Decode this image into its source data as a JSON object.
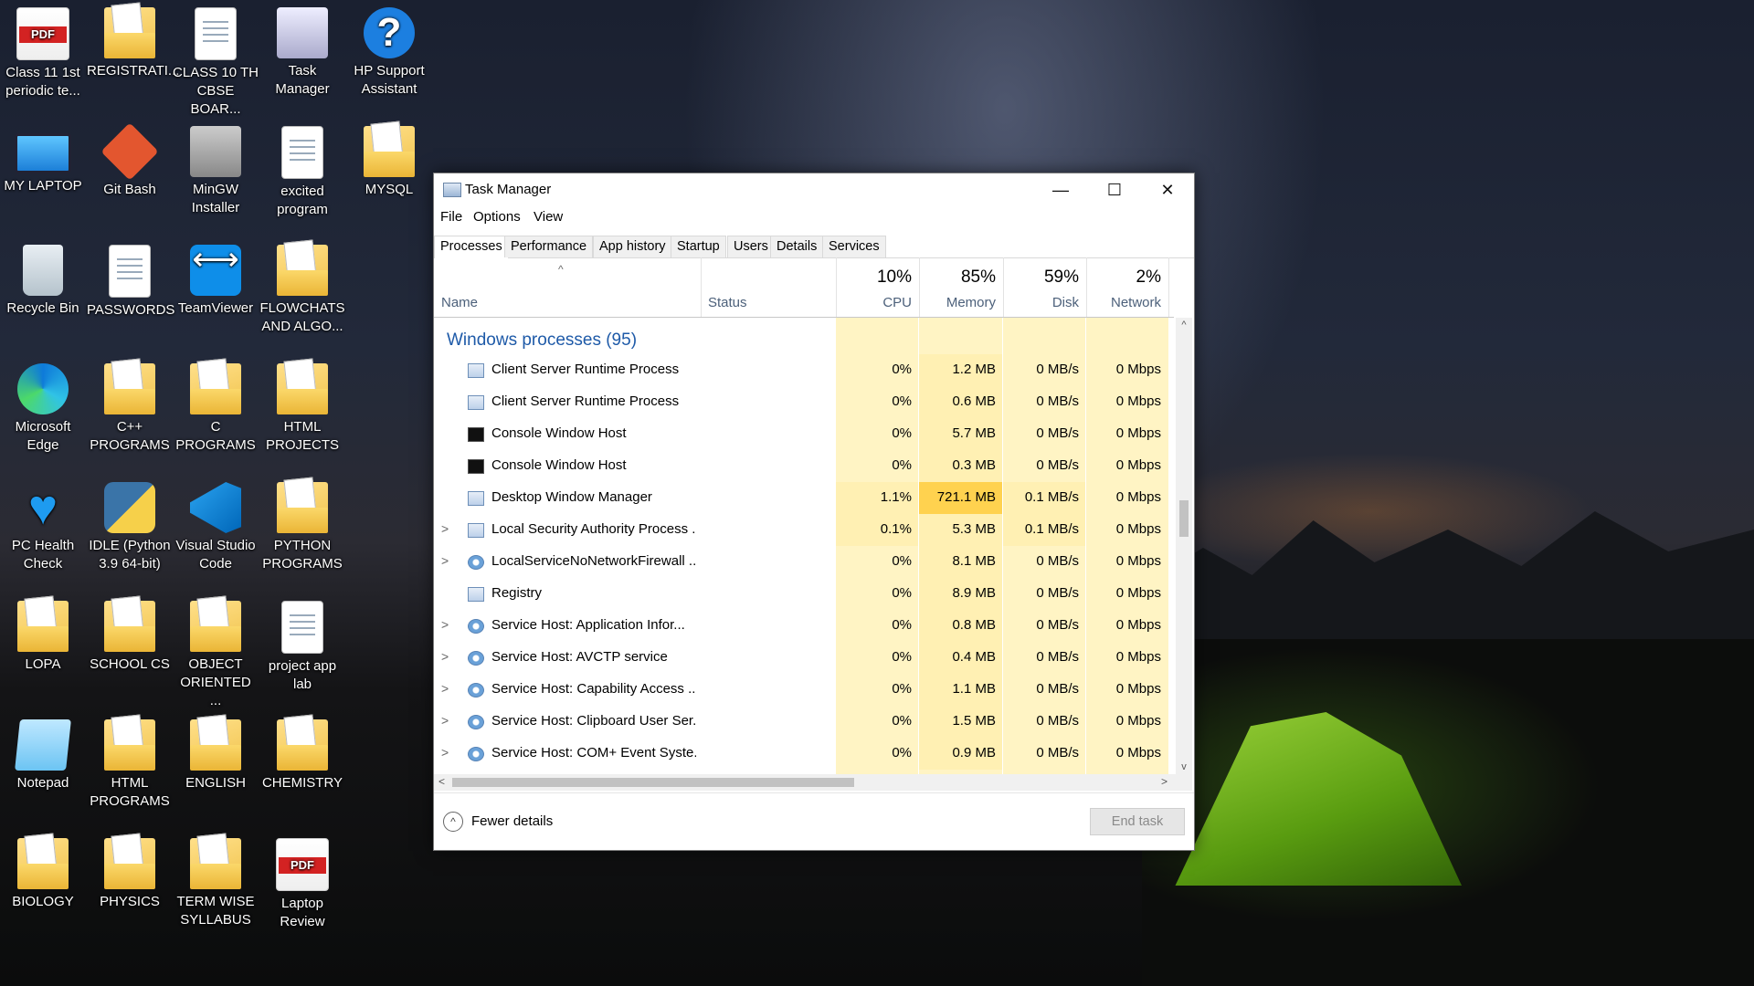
{
  "desktop": {
    "icons": [
      {
        "label": "Class 11 1st periodic te...",
        "icon": "pdf-icon"
      },
      {
        "label": "REGISTRATI...",
        "icon": "folder-icon"
      },
      {
        "label": "CLASS 10 TH CBSE BOAR...",
        "icon": "document-icon"
      },
      {
        "label": "Task Manager",
        "icon": "task-manager-icon"
      },
      {
        "label": "HP Support Assistant",
        "icon": "help-icon"
      },
      {
        "label": "MY LAPTOP",
        "icon": "laptop-icon"
      },
      {
        "label": "Git Bash",
        "icon": "git-icon"
      },
      {
        "label": "MinGW Installer",
        "icon": "installer-icon"
      },
      {
        "label": "excited program",
        "icon": "python-file-icon"
      },
      {
        "label": "MYSQL",
        "icon": "folder-icon"
      },
      {
        "label": "Recycle Bin",
        "icon": "recycle-bin-icon"
      },
      {
        "label": "PASSWORDS",
        "icon": "document-icon"
      },
      {
        "label": "TeamViewer",
        "icon": "teamviewer-icon"
      },
      {
        "label": "FLOWCHATS AND ALGO...",
        "icon": "folder-icon"
      },
      {
        "label": "Microsoft Edge",
        "icon": "edge-icon"
      },
      {
        "label": "C++ PROGRAMS",
        "icon": "folder-icon"
      },
      {
        "label": "C PROGRAMS",
        "icon": "folder-icon"
      },
      {
        "label": "HTML PROJECTS",
        "icon": "folder-icon"
      },
      {
        "label": "PC Health Check",
        "icon": "health-icon"
      },
      {
        "label": "IDLE (Python 3.9 64-bit)",
        "icon": "python-icon"
      },
      {
        "label": "Visual Studio Code",
        "icon": "vscode-icon"
      },
      {
        "label": "PYTHON PROGRAMS",
        "icon": "folder-icon"
      },
      {
        "label": "LOPA",
        "icon": "folder-icon"
      },
      {
        "label": "SCHOOL CS",
        "icon": "folder-icon"
      },
      {
        "label": "OBJECT ORIENTED ...",
        "icon": "folder-icon"
      },
      {
        "label": "project app lab",
        "icon": "document-icon"
      },
      {
        "label": "Notepad",
        "icon": "notepad-icon"
      },
      {
        "label": "HTML PROGRAMS",
        "icon": "folder-icon"
      },
      {
        "label": "ENGLISH",
        "icon": "folder-icon"
      },
      {
        "label": "CHEMISTRY",
        "icon": "folder-icon"
      },
      {
        "label": "BIOLOGY",
        "icon": "folder-icon"
      },
      {
        "label": "PHYSICS",
        "icon": "folder-icon"
      },
      {
        "label": "TERM WISE SYLLABUS",
        "icon": "folder-icon"
      },
      {
        "label": "Laptop Review",
        "icon": "pdf-icon"
      }
    ]
  },
  "window": {
    "title": "Task Manager",
    "minimize_glyph": "—",
    "maximize_glyph": "☐",
    "close_glyph": "✕"
  },
  "menu": {
    "file": "File",
    "options": "Options",
    "view": "View"
  },
  "tabs": [
    "Processes",
    "Performance",
    "App history",
    "Startup",
    "Users",
    "Details",
    "Services"
  ],
  "columns": {
    "name": "Name",
    "status": "Status",
    "cpu": {
      "pct": "10%",
      "label": "CPU"
    },
    "memory": {
      "pct": "85%",
      "label": "Memory"
    },
    "disk": {
      "pct": "59%",
      "label": "Disk"
    },
    "network": {
      "pct": "2%",
      "label": "Network"
    },
    "sort_glyph": "^"
  },
  "group_label": "Windows processes (95)",
  "processes": [
    {
      "name": "Client Server Runtime Process",
      "expand": "",
      "cpu": "0%",
      "memory": "1.2 MB",
      "disk": "0 MB/s",
      "network": "0 Mbps"
    },
    {
      "name": "Client Server Runtime Process",
      "expand": "",
      "cpu": "0%",
      "memory": "0.6 MB",
      "disk": "0 MB/s",
      "network": "0 Mbps"
    },
    {
      "name": "Console Window Host",
      "expand": "",
      "cpu": "0%",
      "memory": "5.7 MB",
      "disk": "0 MB/s",
      "network": "0 Mbps"
    },
    {
      "name": "Console Window Host",
      "expand": "",
      "cpu": "0%",
      "memory": "0.3 MB",
      "disk": "0 MB/s",
      "network": "0 Mbps"
    },
    {
      "name": "Desktop Window Manager",
      "expand": "",
      "cpu": "1.1%",
      "memory": "721.1 MB",
      "disk": "0.1 MB/s",
      "network": "0 Mbps"
    },
    {
      "name": "Local Security Authority Process ...",
      "expand": ">",
      "cpu": "0.1%",
      "memory": "5.3 MB",
      "disk": "0.1 MB/s",
      "network": "0 Mbps"
    },
    {
      "name": "LocalServiceNoNetworkFirewall ...",
      "expand": ">",
      "cpu": "0%",
      "memory": "8.1 MB",
      "disk": "0 MB/s",
      "network": "0 Mbps"
    },
    {
      "name": "Registry",
      "expand": "",
      "cpu": "0%",
      "memory": "8.9 MB",
      "disk": "0 MB/s",
      "network": "0 Mbps"
    },
    {
      "name": "Service Host: Application Infor...",
      "expand": ">",
      "cpu": "0%",
      "memory": "0.8 MB",
      "disk": "0 MB/s",
      "network": "0 Mbps"
    },
    {
      "name": "Service Host: AVCTP service",
      "expand": ">",
      "cpu": "0%",
      "memory": "0.4 MB",
      "disk": "0 MB/s",
      "network": "0 Mbps"
    },
    {
      "name": "Service Host: Capability Access ...",
      "expand": ">",
      "cpu": "0%",
      "memory": "1.1 MB",
      "disk": "0 MB/s",
      "network": "0 Mbps"
    },
    {
      "name": "Service Host: Clipboard User Ser...",
      "expand": ">",
      "cpu": "0%",
      "memory": "1.5 MB",
      "disk": "0 MB/s",
      "network": "0 Mbps"
    },
    {
      "name": "Service Host: COM+ Event Syste...",
      "expand": ">",
      "cpu": "0%",
      "memory": "0.9 MB",
      "disk": "0 MB/s",
      "network": "0 Mbps"
    }
  ],
  "footer": {
    "fewer_details": "Fewer details",
    "fewer_glyph": "^",
    "end_task": "End task"
  },
  "scroll": {
    "up": "^",
    "down": "v",
    "left": "<",
    "right": ">"
  },
  "colors": {
    "heat_light": "#fff4c4",
    "heat_mid": "#fff0b3",
    "heat_hot": "#ffd24f",
    "group_blue": "#1e5aa8"
  }
}
